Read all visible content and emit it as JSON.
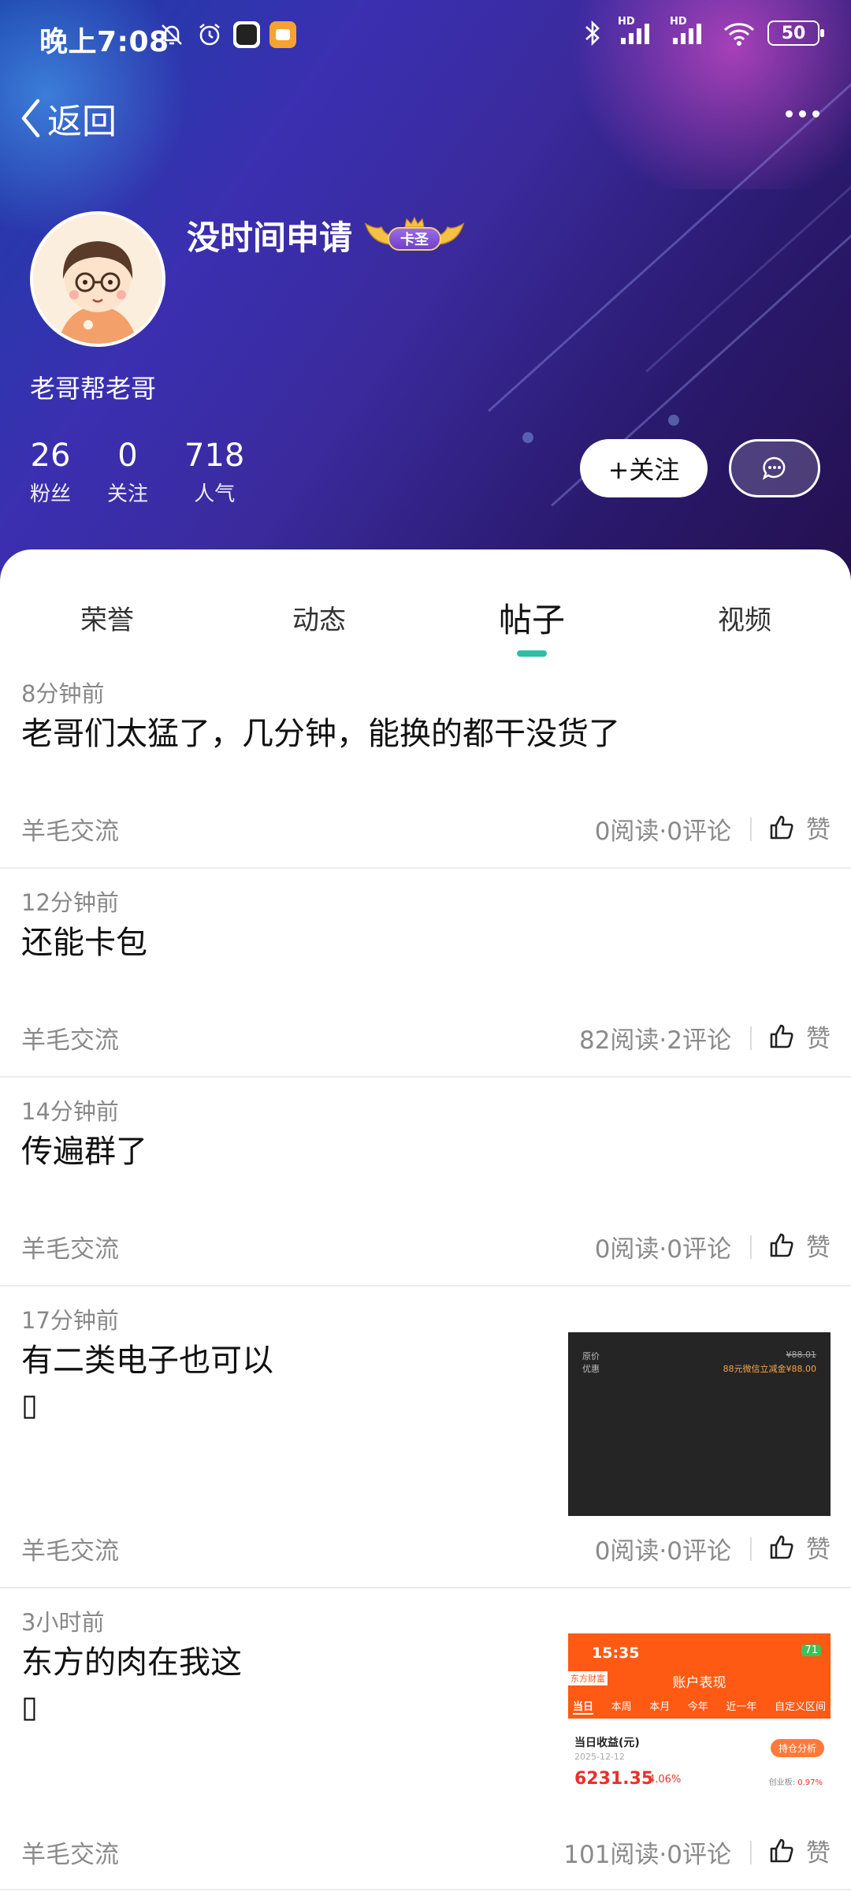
{
  "status_bar": {
    "time": "晚上7:08",
    "battery": "50",
    "network_label": "HD"
  },
  "nav": {
    "back_label": "返回"
  },
  "profile": {
    "name": "没时间申请",
    "badge": "卡圣",
    "subtitle": "老哥帮老哥",
    "stats": [
      {
        "value": "26",
        "label": "粉丝"
      },
      {
        "value": "0",
        "label": "关注"
      },
      {
        "value": "718",
        "label": "人气"
      }
    ],
    "follow_label": "+关注"
  },
  "tabs": [
    {
      "label": "荣誉"
    },
    {
      "label": "动态"
    },
    {
      "label": "帖子"
    },
    {
      "label": "视频"
    }
  ],
  "active_tab": "帖子",
  "accent_color": "#2ebfa6",
  "posts": [
    {
      "time": "8分钟前",
      "title": "老哥们太猛了，几分钟，能换的都干没货了",
      "glyph": "",
      "category": "羊毛交流",
      "meta": "0阅读·0评论",
      "like_label": "赞"
    },
    {
      "time": "12分钟前",
      "title": "还能卡包",
      "glyph": "",
      "category": "羊毛交流",
      "meta": "82阅读·2评论",
      "like_label": "赞"
    },
    {
      "time": "14分钟前",
      "title": "传遍群了",
      "glyph": "",
      "category": "羊毛交流",
      "meta": "0阅读·0评论",
      "like_label": "赞"
    },
    {
      "time": "17分钟前",
      "title": "有二类电子也可以",
      "glyph": "▯",
      "category": "羊毛交流",
      "meta": "0阅读·0评论",
      "like_label": "赞",
      "thumb": {
        "l1": "原价",
        "l2": "优惠",
        "r1": "¥88.01",
        "r2": "88元微信立减金¥88.00"
      }
    },
    {
      "time": "3小时前",
      "title": "东方的肉在我这",
      "glyph": "▯",
      "category": "羊毛交流",
      "meta": "101阅读·0评论",
      "like_label": "赞",
      "thumb": {
        "clock": "15:35",
        "battery": "71",
        "title": "账户表现",
        "mini": "东方财富",
        "tabs": [
          "当日",
          "本周",
          "本月",
          "今年",
          "近一年",
          "自定义区间"
        ],
        "k1": "当日收益(元)",
        "date": "2025-12-12",
        "tag": "持仓分析",
        "amount": "6231.35",
        "pct": "4.06%",
        "gem_label": "创业板:",
        "gem_value": "0.97%"
      }
    }
  ]
}
